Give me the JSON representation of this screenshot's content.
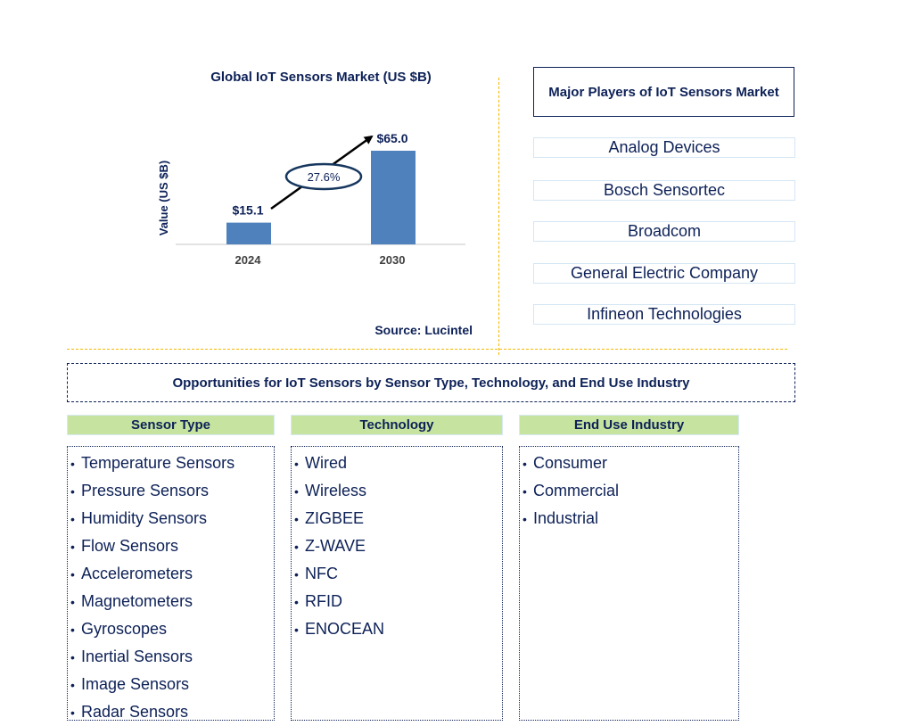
{
  "chart_data": {
    "type": "bar",
    "title": "Global IoT Sensors Market (US $B)",
    "xlabel": "",
    "ylabel": "Value (US $B)",
    "categories": [
      "2024",
      "2030"
    ],
    "values": [
      15.1,
      65.0
    ],
    "data_labels": [
      "$15.1",
      "$65.0"
    ],
    "ylim": [
      0,
      70
    ],
    "grid": false,
    "bar_color": "#4f81bd",
    "annotation": {
      "type": "growth-arrow",
      "label": "27.6%",
      "meaning": "CAGR"
    },
    "source": "Source: Lucintel"
  },
  "players": {
    "title": "Major Players of IoT Sensors Market",
    "items": [
      "Analog Devices",
      "Bosch Sensortec",
      "Broadcom",
      "General Electric Company",
      "Infineon Technologies"
    ]
  },
  "opportunities": {
    "title": "Opportunities for IoT Sensors by Sensor Type, Technology, and End Use Industry",
    "bullet": "•",
    "categories": [
      {
        "header": "Sensor Type",
        "items": [
          "Temperature Sensors",
          "Pressure Sensors",
          "Humidity Sensors",
          "Flow Sensors",
          "Accelerometers",
          "Magnetometers",
          "Gyroscopes",
          "Inertial Sensors",
          "Image Sensors",
          "Radar Sensors"
        ]
      },
      {
        "header": "Technology",
        "items": [
          "Wired",
          "Wireless",
          "ZIGBEE",
          "Z-WAVE",
          "NFC",
          "RFID",
          "ENOCEAN"
        ]
      },
      {
        "header": "End Use Industry",
        "items": [
          "Consumer",
          "Commercial",
          "Industrial"
        ]
      }
    ]
  },
  "colors": {
    "text": "#0d2157",
    "header_fill": "#c6e4a0",
    "divider": "#f5b800",
    "bar": "#4f81bd"
  }
}
